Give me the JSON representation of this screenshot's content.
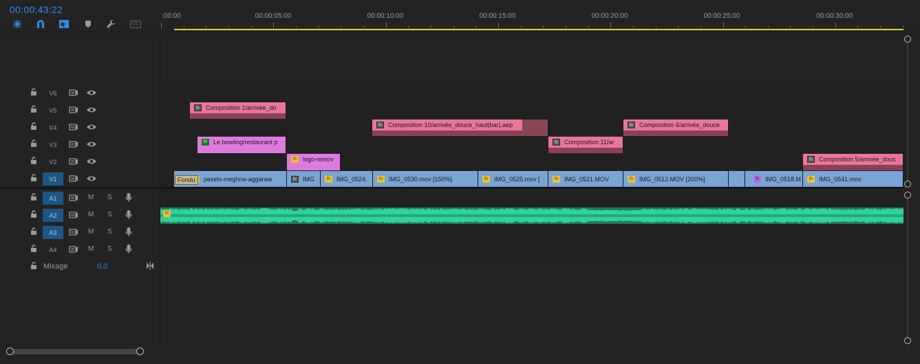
{
  "timecode": "00:00:43:22",
  "toolbar": {
    "tools": [
      "snap-icon",
      "magnet-icon",
      "linked-selection-icon",
      "marker-icon",
      "wrench-icon",
      "captions-icon"
    ],
    "captions_label": "CC"
  },
  "ruler": {
    "labels": [
      ":00:00",
      "00:00:05:00",
      "00:00:10:00",
      "00:00:15:00",
      "00:00:20:00",
      "00:00:25:00",
      "00:00:30:00"
    ]
  },
  "tracks": {
    "video": [
      {
        "id": "V6",
        "target": false
      },
      {
        "id": "V5",
        "target": false
      },
      {
        "id": "V4",
        "target": false
      },
      {
        "id": "V3",
        "target": false
      },
      {
        "id": "V2",
        "target": false
      },
      {
        "id": "V1",
        "target": true
      }
    ],
    "audio": [
      {
        "id": "A1",
        "target": true,
        "m": "M",
        "s": "S"
      },
      {
        "id": "A2",
        "target": true,
        "m": "M",
        "s": "S"
      },
      {
        "id": "A3",
        "target": true,
        "m": "M",
        "s": "S"
      },
      {
        "id": "A4",
        "target": false,
        "m": "M",
        "s": "S"
      }
    ],
    "mix": {
      "label": "Mixage",
      "value": "0,0"
    }
  },
  "clips": {
    "v5": [
      {
        "label": "Composition 1/arrivée_do"
      }
    ],
    "v4": [
      {
        "label": "Composition 10/arrivée_douce_haut(bar).aep"
      },
      {
        "label": "Composition 4/arrivée_douce"
      }
    ],
    "v3": [
      {
        "label": "Le bowling/restaurant p"
      },
      {
        "label": "Composition 11/ar"
      }
    ],
    "v2": [
      {
        "label": "logo-remov"
      },
      {
        "label": "Composition 5/arrivée_douc"
      }
    ],
    "v1": [
      {
        "label": "pexels-meghna-aggarwa"
      },
      {
        "label": "IMG"
      },
      {
        "label": "IMG_0524."
      },
      {
        "label": "IMG_0530.mov [150%]"
      },
      {
        "label": "IMG_0525.mov ["
      },
      {
        "label": "IMG_0521.MOV"
      },
      {
        "label": "IMG_0512.MOV [200%]"
      },
      {
        "label": ""
      },
      {
        "label": "IMG_0518.M"
      },
      {
        "label": "IMG_0541.mov"
      }
    ],
    "transition": "Fondu",
    "fx_label": "fx"
  },
  "colors": {
    "accent": "#2d8ceb",
    "workarea": "#e8d21d",
    "clip_pink": "#e9769a",
    "clip_violet": "#e07ae0",
    "clip_blue": "#7aa4d4",
    "audio_green": "#1f7a58",
    "target_blue": "#1e5785"
  }
}
